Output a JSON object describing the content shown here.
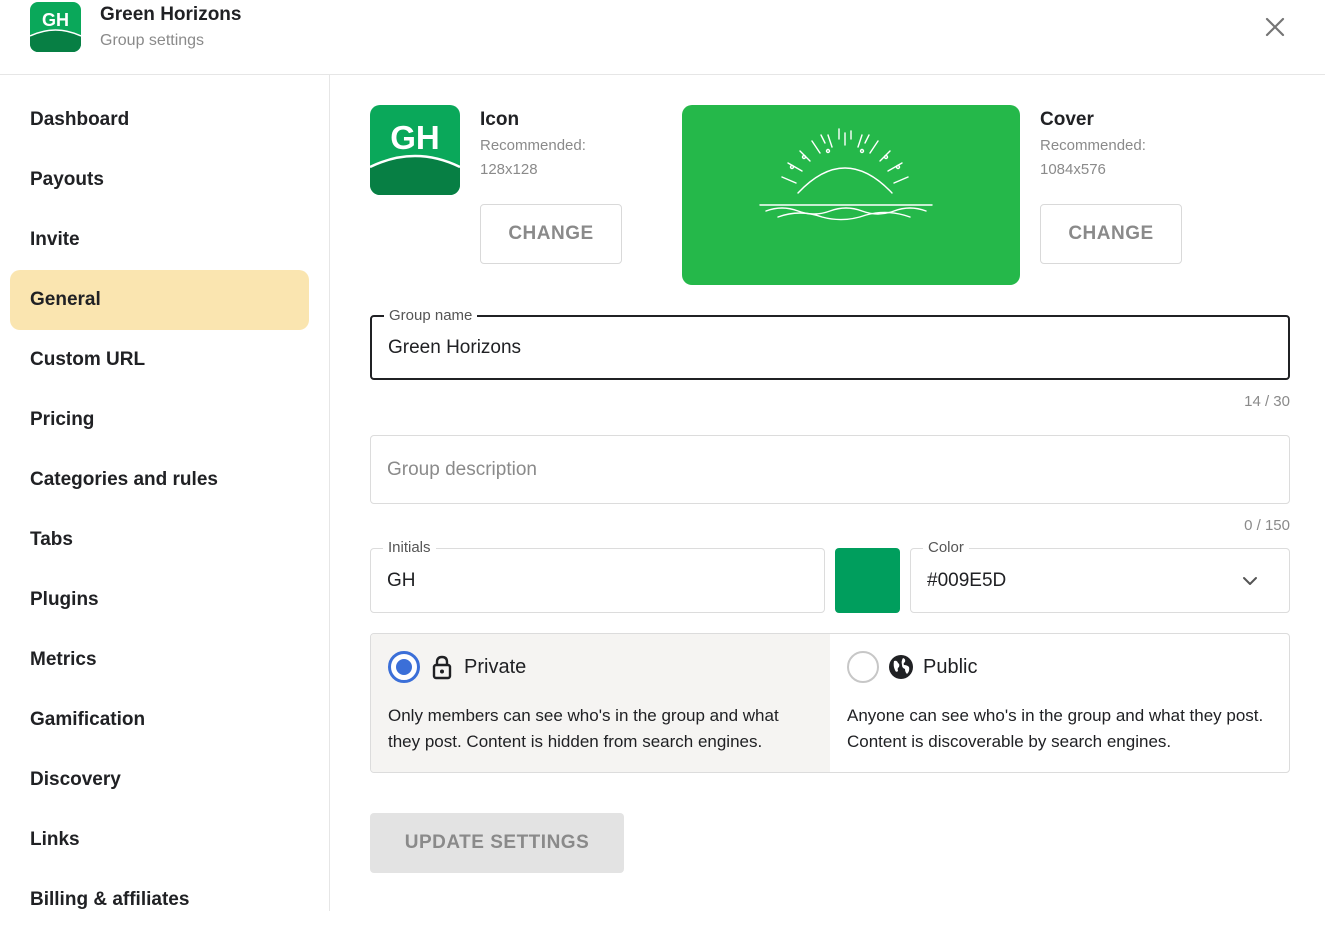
{
  "header": {
    "logo_initials": "GH",
    "title": "Green Horizons",
    "subtitle": "Group settings",
    "close_icon": "close-icon"
  },
  "sidebar": {
    "active": "General",
    "items": [
      {
        "label": "Dashboard"
      },
      {
        "label": "Payouts"
      },
      {
        "label": "Invite"
      },
      {
        "label": "General"
      },
      {
        "label": "Custom URL"
      },
      {
        "label": "Pricing"
      },
      {
        "label": "Categories and rules"
      },
      {
        "label": "Tabs"
      },
      {
        "label": "Plugins"
      },
      {
        "label": "Metrics"
      },
      {
        "label": "Gamification"
      },
      {
        "label": "Discovery"
      },
      {
        "label": "Links"
      },
      {
        "label": "Billing & affiliates"
      }
    ]
  },
  "images": {
    "icon": {
      "label": "Icon",
      "recommended_label": "Recommended:",
      "recommended_size": "128x128",
      "change_label": "CHANGE",
      "preview_initials": "GH"
    },
    "cover": {
      "label": "Cover",
      "recommended_label": "Recommended:",
      "recommended_size": "1084x576",
      "change_label": "CHANGE"
    }
  },
  "form": {
    "group_name": {
      "label": "Group name",
      "value": "Green Horizons",
      "counter": "14 / 30"
    },
    "description": {
      "placeholder": "Group description",
      "value": "",
      "counter": "0 / 150"
    },
    "initials": {
      "label": "Initials",
      "value": "GH"
    },
    "color": {
      "label": "Color",
      "value": "#009E5D",
      "swatch": "#009E5D"
    }
  },
  "privacy": {
    "selected": "Private",
    "private": {
      "title": "Private",
      "icon": "lock-icon",
      "description": "Only members can see who's in the group and what they post. Content is hidden from search engines."
    },
    "public": {
      "title": "Public",
      "icon": "globe-icon",
      "description": "Anyone can see who's in the group and what they post. Content is discoverable by search engines."
    }
  },
  "actions": {
    "update_label": "UPDATE SETTINGS"
  },
  "colors": {
    "brand_green": "#0aa85a",
    "cover_green": "#25b84a",
    "active_nav": "#fae5b0",
    "radio_blue": "#3b6fd8"
  }
}
